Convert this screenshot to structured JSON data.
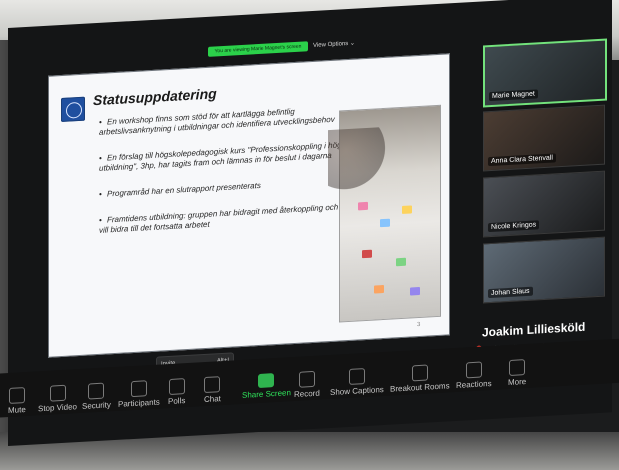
{
  "zoom": {
    "share_pill_text": "You are viewing Marie Magnet's screen",
    "view_options": "View Options ⌄",
    "invite_tag": "Invite",
    "invite_tag_meta": "Alt+I",
    "toolbar": [
      {
        "label": "Mute"
      },
      {
        "label": "Stop Video"
      },
      {
        "label": "Security"
      },
      {
        "label": "Participants"
      },
      {
        "label": "Polls"
      },
      {
        "label": "Chat"
      },
      {
        "label": "Share Screen"
      },
      {
        "label": "Record"
      },
      {
        "label": "Show Captions"
      },
      {
        "label": "Breakout Rooms"
      },
      {
        "label": "Reactions"
      },
      {
        "label": "More"
      }
    ],
    "participants": [
      {
        "name": "Marie Magnet",
        "active": true
      },
      {
        "name": "Anna Clara Stenvall"
      },
      {
        "name": "Nicole Kringos"
      },
      {
        "name": "Johan Slaus"
      }
    ],
    "active_speaker": {
      "name": "Joakim Lilliesköld",
      "subname": "Joakim Lilliesköld"
    }
  },
  "slide": {
    "title": "Statusuppdatering",
    "bullets": [
      "En workshop finns som stöd för att kartlägga befintlig arbetslivsanknytning i utbildningar och identifiera utvecklingsbehov",
      "En förslag till högskolepedagogisk kurs \"Professionskoppling i högre utbildning\", 3hp, har tagits fram och lämnas in för beslut i dagarna",
      "Programråd har en slutrapport presenterats",
      "Framtidens utbildning: gruppen har bidragit med återkoppling och vill bidra till det fortsatta arbetet"
    ],
    "page": "3"
  }
}
